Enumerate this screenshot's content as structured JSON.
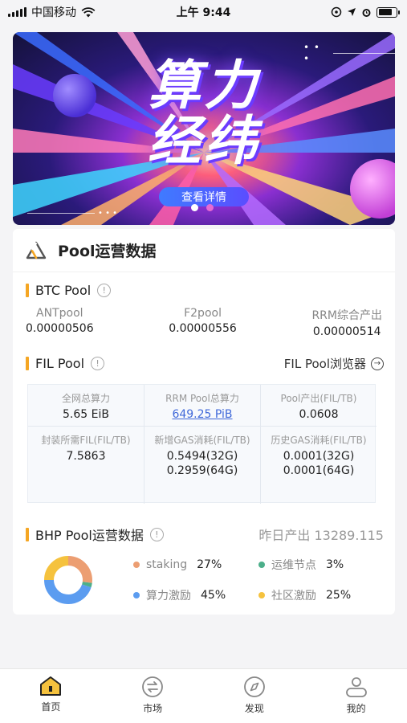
{
  "status_bar": {
    "carrier": "中国移动",
    "time": "上午 9:44"
  },
  "banner": {
    "title_line1": "算力",
    "title_line2": "经纬",
    "button_label": "查看详情",
    "page_count": 2,
    "current_page": 1
  },
  "card": {
    "title": "Pool运营数据",
    "btc": {
      "title": "BTC Pool",
      "info": "!",
      "pools": [
        {
          "name": "ANTpool",
          "value": "0.00000506"
        },
        {
          "name": "F2pool",
          "value": "0.00000556"
        },
        {
          "name": "RRM综合产出",
          "value": "0.00000514"
        }
      ]
    },
    "fil": {
      "title": "FIL Pool",
      "info": "!",
      "browser_link": "FIL Pool浏览器",
      "cells": [
        {
          "label": "全网总算力",
          "value": "5.65 EiB"
        },
        {
          "label": "RRM Pool总算力",
          "value": "649.25 PiB"
        },
        {
          "label": "Pool产出(FIL/TB)",
          "value": "0.0608"
        },
        {
          "label": "封装所需FIL(FIL/TB)",
          "value": "7.5863"
        },
        {
          "label": "新增GAS消耗(FIL/TB)",
          "value": "0.5494(32G)",
          "value2": "0.2959(64G)"
        },
        {
          "label": "历史GAS消耗(FIL/TB)",
          "value": "0.0001(32G)",
          "value2": "0.0001(64G)"
        }
      ]
    },
    "bhp": {
      "title": "BHP Pool运营数据",
      "info": "!",
      "yesterday_output": "昨日产出 13289.115",
      "legend": [
        {
          "label": "staking",
          "pct": "27%",
          "color": "#ec9e72"
        },
        {
          "label": "运维节点",
          "pct": "3%",
          "color": "#4caf8a"
        },
        {
          "label": "算力激励",
          "pct": "45%",
          "color": "#5b9cf0"
        },
        {
          "label": "社区激励",
          "pct": "25%",
          "color": "#f5c23e"
        }
      ]
    }
  },
  "chart_data": {
    "type": "pie",
    "categories": [
      "staking",
      "运维节点",
      "算力激励",
      "社区激励"
    ],
    "values": [
      27,
      3,
      45,
      25
    ],
    "colors": [
      "#ec9e72",
      "#4caf8a",
      "#5b9cf0",
      "#f5c23e"
    ]
  },
  "tabs": [
    {
      "label": "首页",
      "icon": "home-icon",
      "active": true
    },
    {
      "label": "市场",
      "icon": "exchange-icon",
      "active": false
    },
    {
      "label": "发现",
      "icon": "compass-icon",
      "active": false
    },
    {
      "label": "我的",
      "icon": "user-icon",
      "active": false
    }
  ]
}
